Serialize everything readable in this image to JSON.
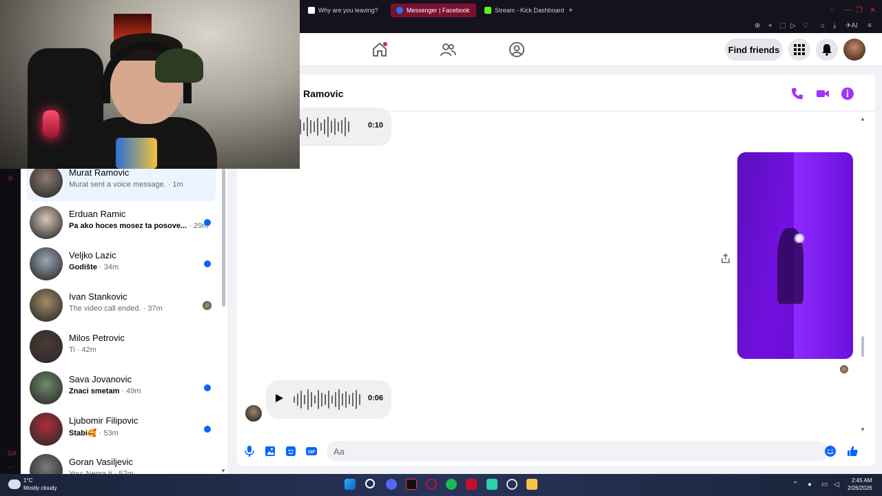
{
  "browser": {
    "tabs": [
      {
        "label": "Why are you leaving?",
        "favicon_color": "#ffffff"
      },
      {
        "label": "Messenger | Facebook",
        "favicon_color": "#1877f2"
      },
      {
        "label": "Stream - Kick Dashboard",
        "favicon_color": "#53fc18"
      }
    ],
    "new_tab": "+",
    "toolbar_ai": "AI"
  },
  "facebook_header": {
    "find_friends_label": "Find friends",
    "home_has_badge": true,
    "accent": "#0866ff"
  },
  "chat_list": [
    {
      "name": "Murat Ramovic",
      "snippet": "Murat sent a voice message.",
      "time": "1m",
      "unread": false,
      "active": true,
      "avatar_color": "#8d7b6e"
    },
    {
      "name": "Erduan Ramic",
      "snippet": "Pa ako hoces mosez ta posove...",
      "time": "29m",
      "unread": true,
      "active": false,
      "avatar_color": "#d8c7b8"
    },
    {
      "name": "Veljko Lazic",
      "snippet": "Godište",
      "time": "34m",
      "unread": true,
      "active": false,
      "avatar_color": "#9aa7b5"
    },
    {
      "name": "Ivan Stankovic",
      "snippet": "The video call ended.",
      "time": "37m",
      "unread": false,
      "active": false,
      "seen_avatar": true,
      "avatar_color": "#a08d63"
    },
    {
      "name": "Milos Petrovic",
      "snippet": "Ti",
      "time": "42m",
      "unread": false,
      "active": false,
      "avatar_color": "#4c3a34"
    },
    {
      "name": "Sava Jovanovic",
      "snippet": "Znaci smetam",
      "time": "49m",
      "unread": true,
      "active": false,
      "avatar_color": "#6f8b6a"
    },
    {
      "name": "Ljubomir Filipovic",
      "snippet": "Stabi🥰",
      "time": "53m",
      "unread": true,
      "active": false,
      "avatar_color": "#b12c35"
    },
    {
      "name": "Goran Vasiljevic",
      "snippet": "You: Nema ti",
      "time": "57m",
      "unread": false,
      "active": false,
      "avatar_color": "#7a7a7a"
    }
  ],
  "conversation": {
    "partner_name": "Ramovic",
    "messages": [
      {
        "type": "voice",
        "duration": "0:10"
      },
      {
        "type": "image",
        "description": "purple-photo"
      },
      {
        "type": "voice",
        "duration": "0:06"
      }
    ],
    "composer_placeholder": "Aa",
    "accent": "#a033ff"
  },
  "taskbar": {
    "temperature": "1°C",
    "weather": "Mostly cloudy",
    "time": "2:45 AM",
    "date": "2/26/2026"
  }
}
